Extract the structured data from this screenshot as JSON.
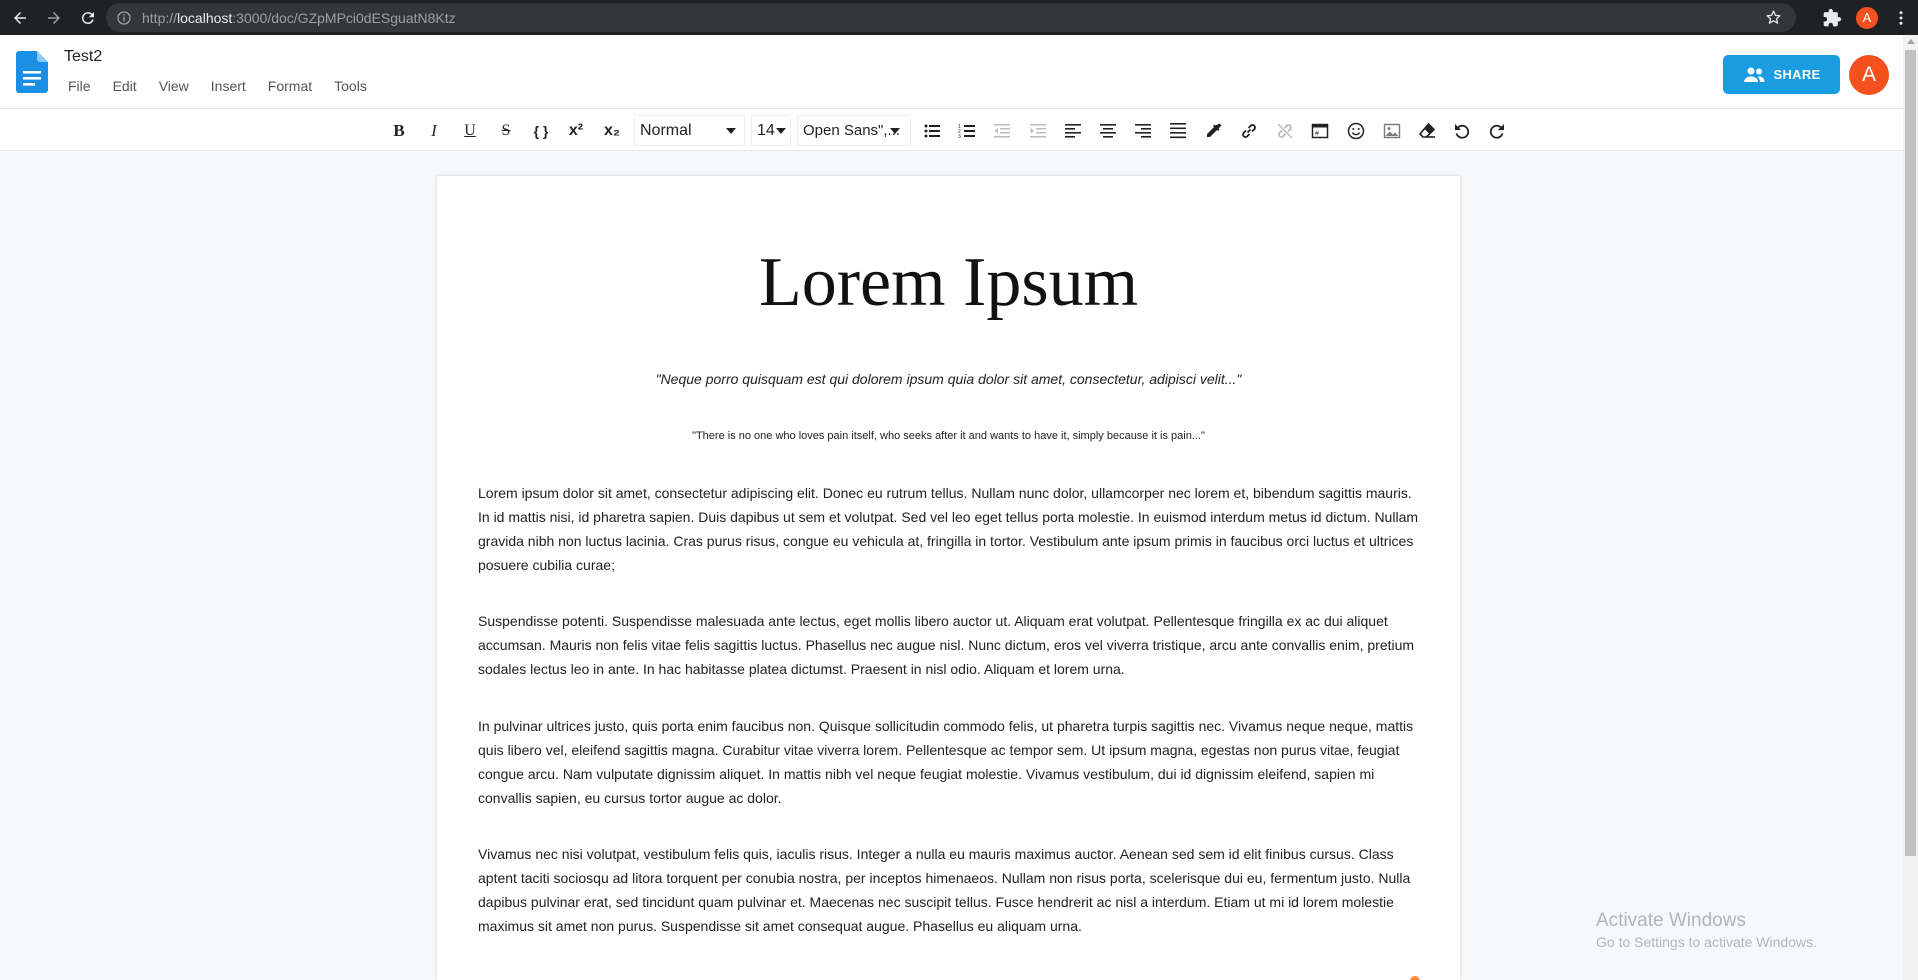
{
  "browser": {
    "url_scheme": "http://",
    "url_host": "localhost",
    "url_path": ":3000/doc/GZpMPci0dESguatN8Ktz",
    "profile_letter": "A"
  },
  "header": {
    "title": "Test2",
    "menu": [
      "File",
      "Edit",
      "View",
      "Insert",
      "Format",
      "Tools"
    ],
    "share_label": "SHARE",
    "avatar_letter": "A",
    "brand_color": "#1a9ce0",
    "avatar_color": "#f4511e"
  },
  "toolbar": {
    "bold": "B",
    "italic": "I",
    "underline": "U",
    "strike": "S",
    "code": "{ }",
    "superscript": "x²",
    "subscript": "x₂",
    "heading_select": "Normal",
    "size_select": "14",
    "font_select": "Open Sans\",..."
  },
  "document": {
    "title": "Lorem Ipsum",
    "quote1": "\"Neque porro quisquam est qui dolorem ipsum quia dolor sit amet, consectetur, adipisci velit...\"",
    "quote2": "\"There is no one who loves pain itself, who seeks after it and wants to have it, simply because it is pain...\"",
    "paragraphs": [
      "Lorem ipsum dolor sit amet, consectetur adipiscing elit. Donec eu rutrum tellus. Nullam nunc dolor, ullamcorper nec lorem et, bibendum sagittis mauris. In id mattis nisi, id pharetra sapien. Duis dapibus ut sem et volutpat. Sed vel leo eget tellus porta molestie. In euismod interdum metus id dictum. Nullam gravida nibh non luctus lacinia. Cras purus risus, congue eu vehicula at, fringilla in tortor. Vestibulum ante ipsum primis in faucibus orci luctus et ultrices posuere cubilia curae;",
      "Suspendisse potenti. Suspendisse malesuada ante lectus, eget mollis libero auctor ut. Aliquam erat volutpat. Pellentesque fringilla ex ac dui aliquet accumsan. Mauris non felis vitae felis sagittis luctus. Phasellus nec augue nisl. Nunc dictum, eros vel viverra tristique, arcu ante convallis enim, pretium sodales lectus leo in ante. In hac habitasse platea dictumst. Praesent in nisl odio. Aliquam et lorem urna.",
      "In pulvinar ultrices justo, quis porta enim faucibus non. Quisque sollicitudin commodo felis, ut pharetra turpis sagittis nec. Vivamus neque neque, mattis quis libero vel, eleifend sagittis magna. Curabitur vitae viverra lorem. Pellentesque ac tempor sem. Ut ipsum magna, egestas non purus vitae, feugiat congue arcu. Nam vulputate dignissim aliquet. In mattis nibh vel neque feugiat molestie. Vivamus vestibulum, dui id dignissim eleifend, sapien mi convallis sapien, eu cursus tortor augue ac dolor.",
      "Vivamus nec nisi volutpat, vestibulum felis quis, iaculis risus. Integer a nulla eu mauris maximus auctor. Aenean sed sem id elit finibus cursus. Class aptent taciti sociosqu ad litora torquent per conubia nostra, per inceptos himenaeos. Nullam non risus porta, scelerisque dui eu, fermentum justo. Nulla dapibus pulvinar erat, sed tincidunt quam pulvinar et. Maecenas nec suscipit tellus. Fusce hendrerit ac nisl a interdum. Etiam ut mi id lorem molestie maximus sit amet non purus. Suspendisse sit amet consequat augue. Phasellus eu aliquam urna."
    ]
  },
  "watermark": {
    "line1": "Activate Windows",
    "line2": "Go to Settings to activate Windows."
  }
}
